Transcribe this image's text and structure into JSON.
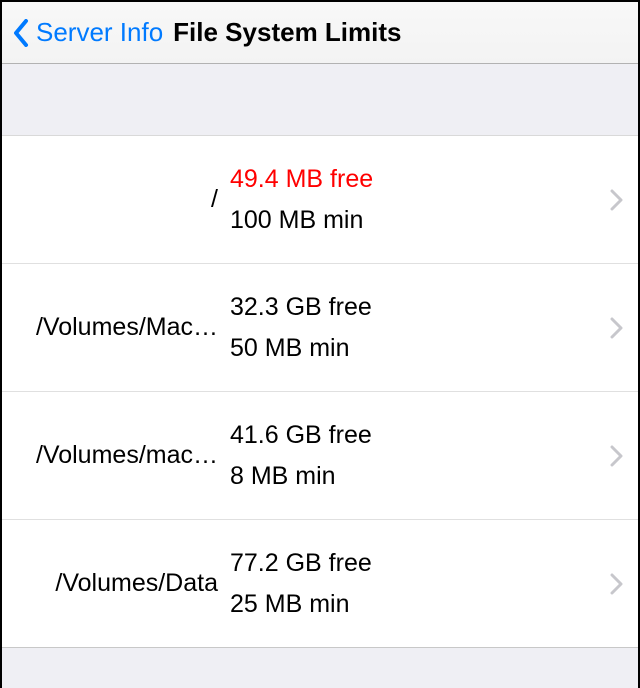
{
  "nav": {
    "back_label": "Server Info",
    "title": "File System Limits"
  },
  "list": {
    "items": [
      {
        "path": "/",
        "free": "49.4 MB free",
        "min": "100 MB min",
        "warning": true
      },
      {
        "path": "/Volumes/Mac…",
        "free": "32.3 GB free",
        "min": "50 MB min",
        "warning": false
      },
      {
        "path": "/Volumes/mac…",
        "free": "41.6 GB free",
        "min": "8 MB min",
        "warning": false
      },
      {
        "path": "/Volumes/Data",
        "free": "77.2 GB free",
        "min": "25 MB min",
        "warning": false
      }
    ]
  }
}
